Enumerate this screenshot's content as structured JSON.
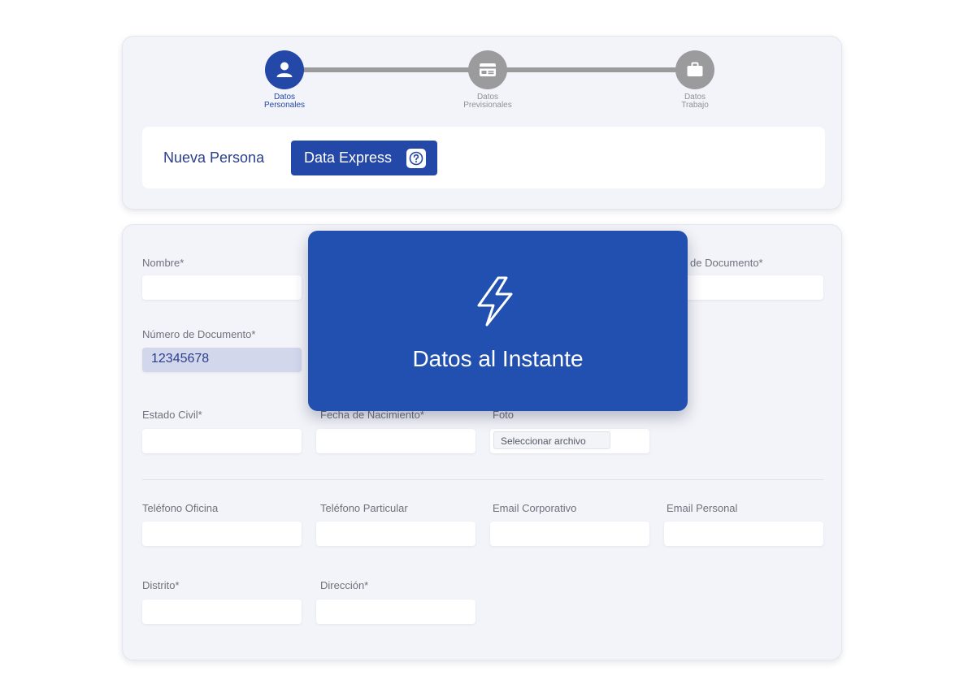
{
  "stepper": {
    "steps": [
      {
        "label": "Datos\nPersonales",
        "icon": "person-icon",
        "active": true
      },
      {
        "label": "Datos\nPrevisionales",
        "icon": "card-icon",
        "active": false
      },
      {
        "label": "Datos\nTrabajo",
        "icon": "briefcase-icon",
        "active": false
      }
    ]
  },
  "header": {
    "title": "Nueva Persona",
    "express_button": "Data Express",
    "help_icon": "question-icon"
  },
  "form": {
    "nombre_label": "Nombre*",
    "tipo_documento_label": "de Documento*",
    "numero_documento_label": "Número de Documento*",
    "numero_documento_value": "12345678",
    "estado_civil_label": "Estado Civil*",
    "fecha_nacimiento_label": "Fecha de Nacimiento*",
    "foto_label": "Foto",
    "foto_button": "Seleccionar archivo",
    "telefono_oficina_label": "Teléfono Oficina",
    "telefono_particular_label": "Teléfono Particular",
    "email_corporativo_label": "Email Corporativo",
    "email_personal_label": "Email Personal",
    "distrito_label": "Distrito*",
    "direccion_label": "Dirección*"
  },
  "overlay": {
    "icon": "lightning-icon",
    "text": "Datos al Instante"
  },
  "colors": {
    "primary": "#2348a8",
    "overlay": "#2250b0",
    "inactive_step": "#9b9b9e",
    "card_bg": "#f3f4f9"
  }
}
